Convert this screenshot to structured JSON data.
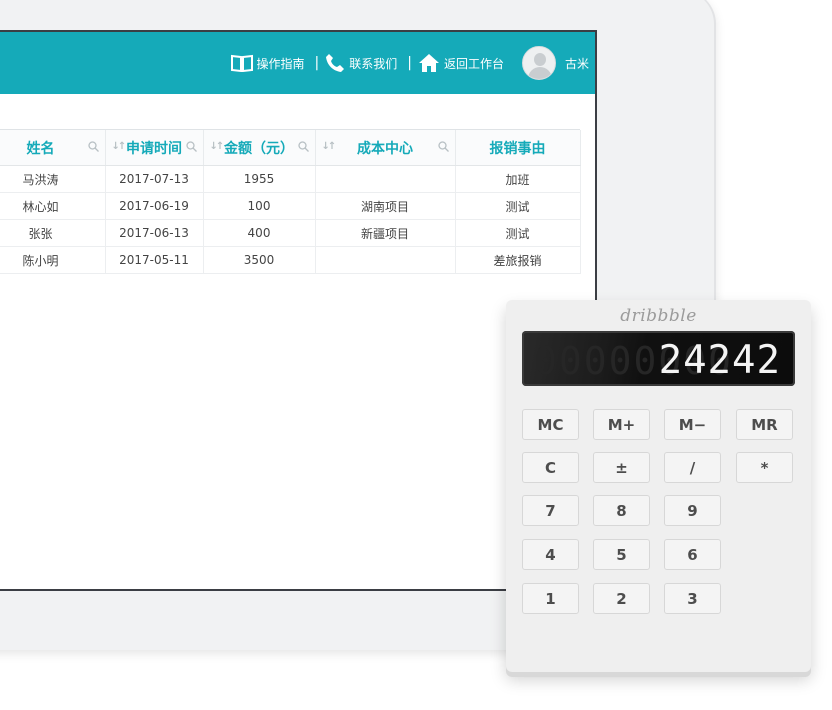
{
  "header": {
    "nav": [
      {
        "label": "操作指南",
        "icon": "book-icon"
      },
      {
        "label": "联系我们",
        "icon": "phone-icon"
      },
      {
        "label": "返回工作台",
        "icon": "home-icon"
      }
    ],
    "separator": "|",
    "user_name": "古米"
  },
  "table": {
    "columns": [
      {
        "label": "",
        "sortable": false,
        "searchable": true
      },
      {
        "label": "姓名",
        "sortable": true,
        "searchable": true
      },
      {
        "label": "申请时间",
        "sortable": true,
        "searchable": true
      },
      {
        "label": "金额（元）",
        "sortable": true,
        "searchable": true
      },
      {
        "label": "成本中心",
        "sortable": true,
        "searchable": true
      },
      {
        "label": "报销事由",
        "sortable": false,
        "searchable": false
      }
    ],
    "rows": [
      [
        "",
        "马洪涛",
        "2017-07-13",
        "1955",
        "",
        "加班"
      ],
      [
        "",
        "林心如",
        "2017-06-19",
        "100",
        "湖南项目",
        "测试"
      ],
      [
        "",
        "张张",
        "2017-06-13",
        "400",
        "新疆项目",
        "测试"
      ],
      [
        "",
        "陈小明",
        "2017-05-11",
        "3500",
        "",
        "差旅报销"
      ]
    ]
  },
  "calculator": {
    "brand": "dribbble",
    "display_ghost": "00000000",
    "display_value": "24242",
    "keys": [
      [
        "MC",
        "M+",
        "M−",
        "MR"
      ],
      [
        "C",
        "±",
        "/",
        "*"
      ],
      [
        "7",
        "8",
        "9"
      ],
      [
        "4",
        "5",
        "6"
      ],
      [
        "1",
        "2",
        "3"
      ]
    ]
  },
  "colors": {
    "accent": "#15aab9",
    "tablet_frame": "#f1f2f3",
    "calculator_body": "#efefef",
    "display_bg": "#111111"
  }
}
